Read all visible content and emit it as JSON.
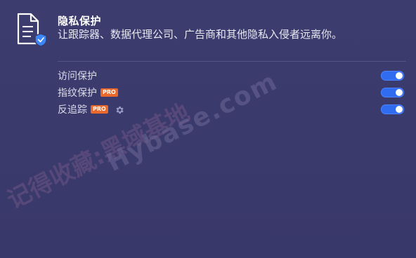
{
  "header": {
    "icon": "shield-document-icon",
    "title": "隐私保护",
    "subtitle": "让跟踪器、数据代理公司、广告商和其他隐私入侵者远离你。"
  },
  "settings": [
    {
      "label": "访问保护",
      "pro": false,
      "gear": false,
      "enabled": true
    },
    {
      "label": "指纹保护",
      "pro": true,
      "gear": false,
      "enabled": true
    },
    {
      "label": "反追踪",
      "pro": true,
      "gear": true,
      "enabled": true
    }
  ],
  "badge_text": "PRO",
  "watermark": {
    "line1": "记得收藏:黑域基地",
    "line2": "Hybase.com"
  },
  "colors": {
    "background": "#3a3a6b",
    "toggle_on": "#2f6cf0",
    "pro_badge": "#e8692b",
    "shield_accent": "#3d86f5"
  }
}
